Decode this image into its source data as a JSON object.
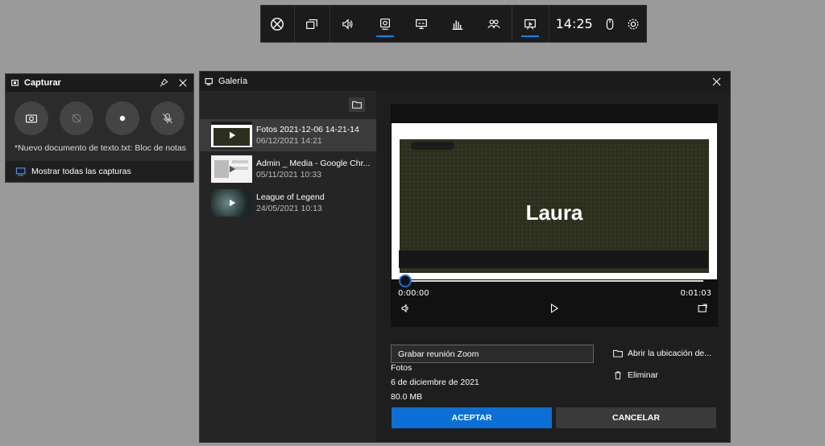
{
  "topbar": {
    "time": "14:25",
    "buttons": [
      "xbox-icon",
      "widget-menu-icon",
      "audio-icon",
      "capture-icon",
      "performance-icon",
      "resources-icon",
      "social-icon",
      "gallery-icon"
    ]
  },
  "capture": {
    "title": "Capturar",
    "recent": "*Nuevo documento de texto.txt: Bloc de notas",
    "show_all": "Mostrar todas las capturas"
  },
  "gallery": {
    "title": "Galería",
    "items": [
      {
        "name": "Fotos 2021-12-06 14-21-14",
        "date": "06/12/2021 14:21"
      },
      {
        "name": "Admin _ Media - Google Chr...",
        "date": "05/11/2021 10:33"
      },
      {
        "name": "League of Legend",
        "date": "24/05/2021 10:13"
      }
    ],
    "preview": {
      "participant": "Laura",
      "time_start": "0:00:00",
      "time_end": "0:01:03",
      "progress": 0.0
    },
    "rename_value": "Grabar reunión Zoom",
    "app": "Fotos",
    "date": "6 de diciembre de 2021",
    "size": "80.0 MB",
    "open_location": "Abrir la ubicación de...",
    "delete": "Eliminar",
    "accept": "ACEPTAR",
    "cancel": "CANCELAR"
  },
  "colors": {
    "accent": "#0a70d6"
  }
}
